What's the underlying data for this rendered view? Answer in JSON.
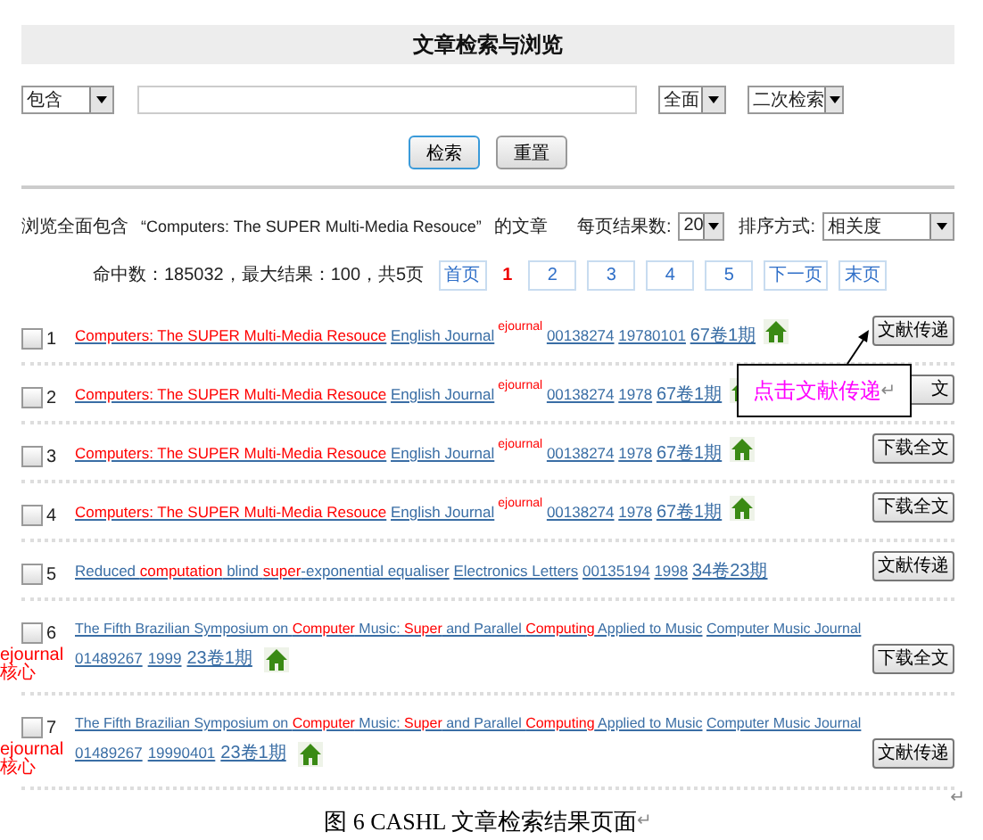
{
  "header": {
    "title": "文章检索与浏览"
  },
  "search": {
    "match": "包含",
    "scope": "全面",
    "mode": "二次检索",
    "buttons": [
      {
        "label": "检索",
        "primary": true
      },
      {
        "label": "重置",
        "primary": false
      }
    ]
  },
  "summary": {
    "prefix": "浏览全面包含",
    "query": "“Computers: The SUPER Multi-Media Resouce”",
    "suffix": "的文章",
    "per_page_label": "每页结果数:",
    "per_page": "20",
    "sort_label": "排序方式:",
    "sort": "相关度"
  },
  "stats": "命中数：185032，最大结果：100，共5页",
  "pagination": [
    {
      "label": "首页",
      "selected": false
    },
    {
      "label": "1",
      "selected": true
    },
    {
      "label": "2",
      "selected": false
    },
    {
      "label": "3",
      "selected": false
    },
    {
      "label": "4",
      "selected": false
    },
    {
      "label": "5",
      "selected": false
    },
    {
      "label": "下一页",
      "selected": false
    },
    {
      "label": "末页",
      "selected": false
    }
  ],
  "results": [
    {
      "number": "1",
      "kind": "single",
      "checked": false,
      "title": [
        {
          "text": "Computers: The SUPER Multi-Media Resouce",
          "highlight": true
        }
      ],
      "journal": "English Journal",
      "tag": "ejournal",
      "issn": "00138274",
      "date": "19780101",
      "volume": "67卷1期",
      "home": true,
      "action": "文献传递"
    },
    {
      "number": "2",
      "kind": "single",
      "checked": false,
      "title": [
        {
          "text": "Computers: The SUPER Multi-Media Resouce",
          "highlight": true
        }
      ],
      "journal": "English Journal",
      "tag": "ejournal",
      "issn": "00138274",
      "date": "1978",
      "volume": "67卷1期",
      "home": true,
      "action": "文"
    },
    {
      "number": "3",
      "kind": "single",
      "checked": false,
      "title": [
        {
          "text": "Computers: The SUPER Multi-Media Resouce",
          "highlight": true
        }
      ],
      "journal": "English Journal",
      "tag": "ejournal",
      "issn": "00138274",
      "date": "1978",
      "volume": "67卷1期",
      "home": true,
      "action": "下载全文"
    },
    {
      "number": "4",
      "kind": "single",
      "checked": false,
      "title": [
        {
          "text": "Computers: The SUPER Multi-Media Resouce",
          "highlight": true
        }
      ],
      "journal": "English Journal",
      "tag": "ejournal",
      "issn": "00138274",
      "date": "1978",
      "volume": "67卷1期",
      "home": true,
      "action": "下载全文"
    },
    {
      "number": "5",
      "kind": "single",
      "checked": false,
      "title": [
        {
          "text": "Reduced ",
          "highlight": false
        },
        {
          "text": "computation",
          "highlight": true
        },
        {
          "text": " blind ",
          "highlight": false
        },
        {
          "text": "super",
          "highlight": true
        },
        {
          "text": "-exponential equaliser",
          "highlight": false
        }
      ],
      "journal": "Electronics Letters",
      "issn": "00135194",
      "date": "1998",
      "volume": "34卷23期",
      "home": false,
      "action": "文献传递"
    },
    {
      "number": "6",
      "kind": "wrapped",
      "checked": false,
      "title": [
        {
          "text": "The Fifth Brazilian Symposium on ",
          "highlight": false
        },
        {
          "text": "Computer",
          "highlight": true
        },
        {
          "text": " Music: ",
          "highlight": false
        },
        {
          "text": "Super",
          "highlight": true
        },
        {
          "text": " and Parallel ",
          "highlight": false
        },
        {
          "text": "Computing",
          "highlight": true
        },
        {
          "text": " Applied to Music",
          "highlight": false
        }
      ],
      "journal": "Computer Music Journal",
      "tag": "ejournal 核心",
      "issn": "01489267",
      "date": "1999",
      "volume": "23卷1期",
      "home": true,
      "action": "下载全文"
    },
    {
      "number": "7",
      "kind": "wrapped",
      "checked": false,
      "title": [
        {
          "text": "The Fifth Brazilian Symposium on ",
          "highlight": false
        },
        {
          "text": "Computer",
          "highlight": true
        },
        {
          "text": " Music: ",
          "highlight": false
        },
        {
          "text": "Super",
          "highlight": true
        },
        {
          "text": " and Parallel ",
          "highlight": false
        },
        {
          "text": "Computing",
          "highlight": true
        },
        {
          "text": " Applied to Music",
          "highlight": false
        }
      ],
      "journal": "Computer Music Journal",
      "tag": "ejournal 核心",
      "issn": "01489267",
      "date": "19990401",
      "volume": "23卷1期",
      "home": true,
      "action": "文献传递"
    }
  ],
  "callout": {
    "text": "点击文献传递",
    "mark": "↵"
  },
  "end_mark": "↵",
  "caption": {
    "text": "图 6 CASHL 文章检索结果页面",
    "mark": "↵"
  }
}
